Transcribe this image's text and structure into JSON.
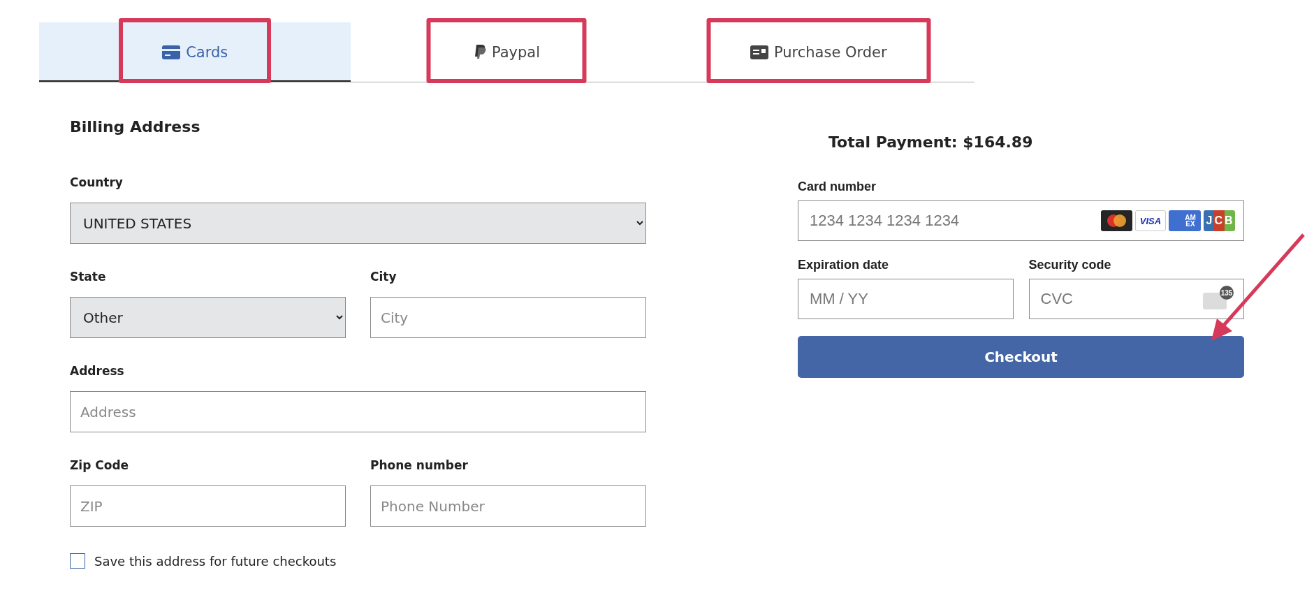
{
  "tabs": [
    {
      "kind": "card",
      "label": "Cards",
      "selected": true,
      "highlighted": true
    },
    {
      "kind": "paypal",
      "label": "Paypal",
      "selected": false,
      "highlighted": true
    },
    {
      "kind": "po",
      "label": "Purchase Order",
      "selected": false,
      "highlighted": true
    }
  ],
  "billing": {
    "heading": "Billing Address",
    "country": {
      "label": "Country",
      "value": "UNITED STATES"
    },
    "state": {
      "label": "State",
      "value": "Other"
    },
    "city": {
      "label": "City",
      "placeholder": "City"
    },
    "address": {
      "label": "Address",
      "placeholder": "Address"
    },
    "zip": {
      "label": "Zip Code",
      "placeholder": "ZIP"
    },
    "phone": {
      "label": "Phone number",
      "placeholder": "Phone Number"
    },
    "save_address": {
      "label": "Save this address for future checkouts",
      "checked": false
    }
  },
  "payment": {
    "total": "Total Payment: $164.89",
    "card_number": {
      "label": "Card number",
      "placeholder": "1234 1234 1234 1234"
    },
    "card_brands": [
      {
        "kind": "mastercard"
      },
      {
        "kind": "visa",
        "label": "VISA"
      },
      {
        "kind": "amex",
        "label": "AM EX"
      },
      {
        "kind": "jcb",
        "label": "JCB"
      }
    ],
    "expiration": {
      "label": "Expiration date",
      "placeholder": "MM / YY"
    },
    "security": {
      "label": "Security code",
      "placeholder": "CVC",
      "hint": "135"
    },
    "checkout": "Checkout"
  },
  "annotation_arrow": true
}
